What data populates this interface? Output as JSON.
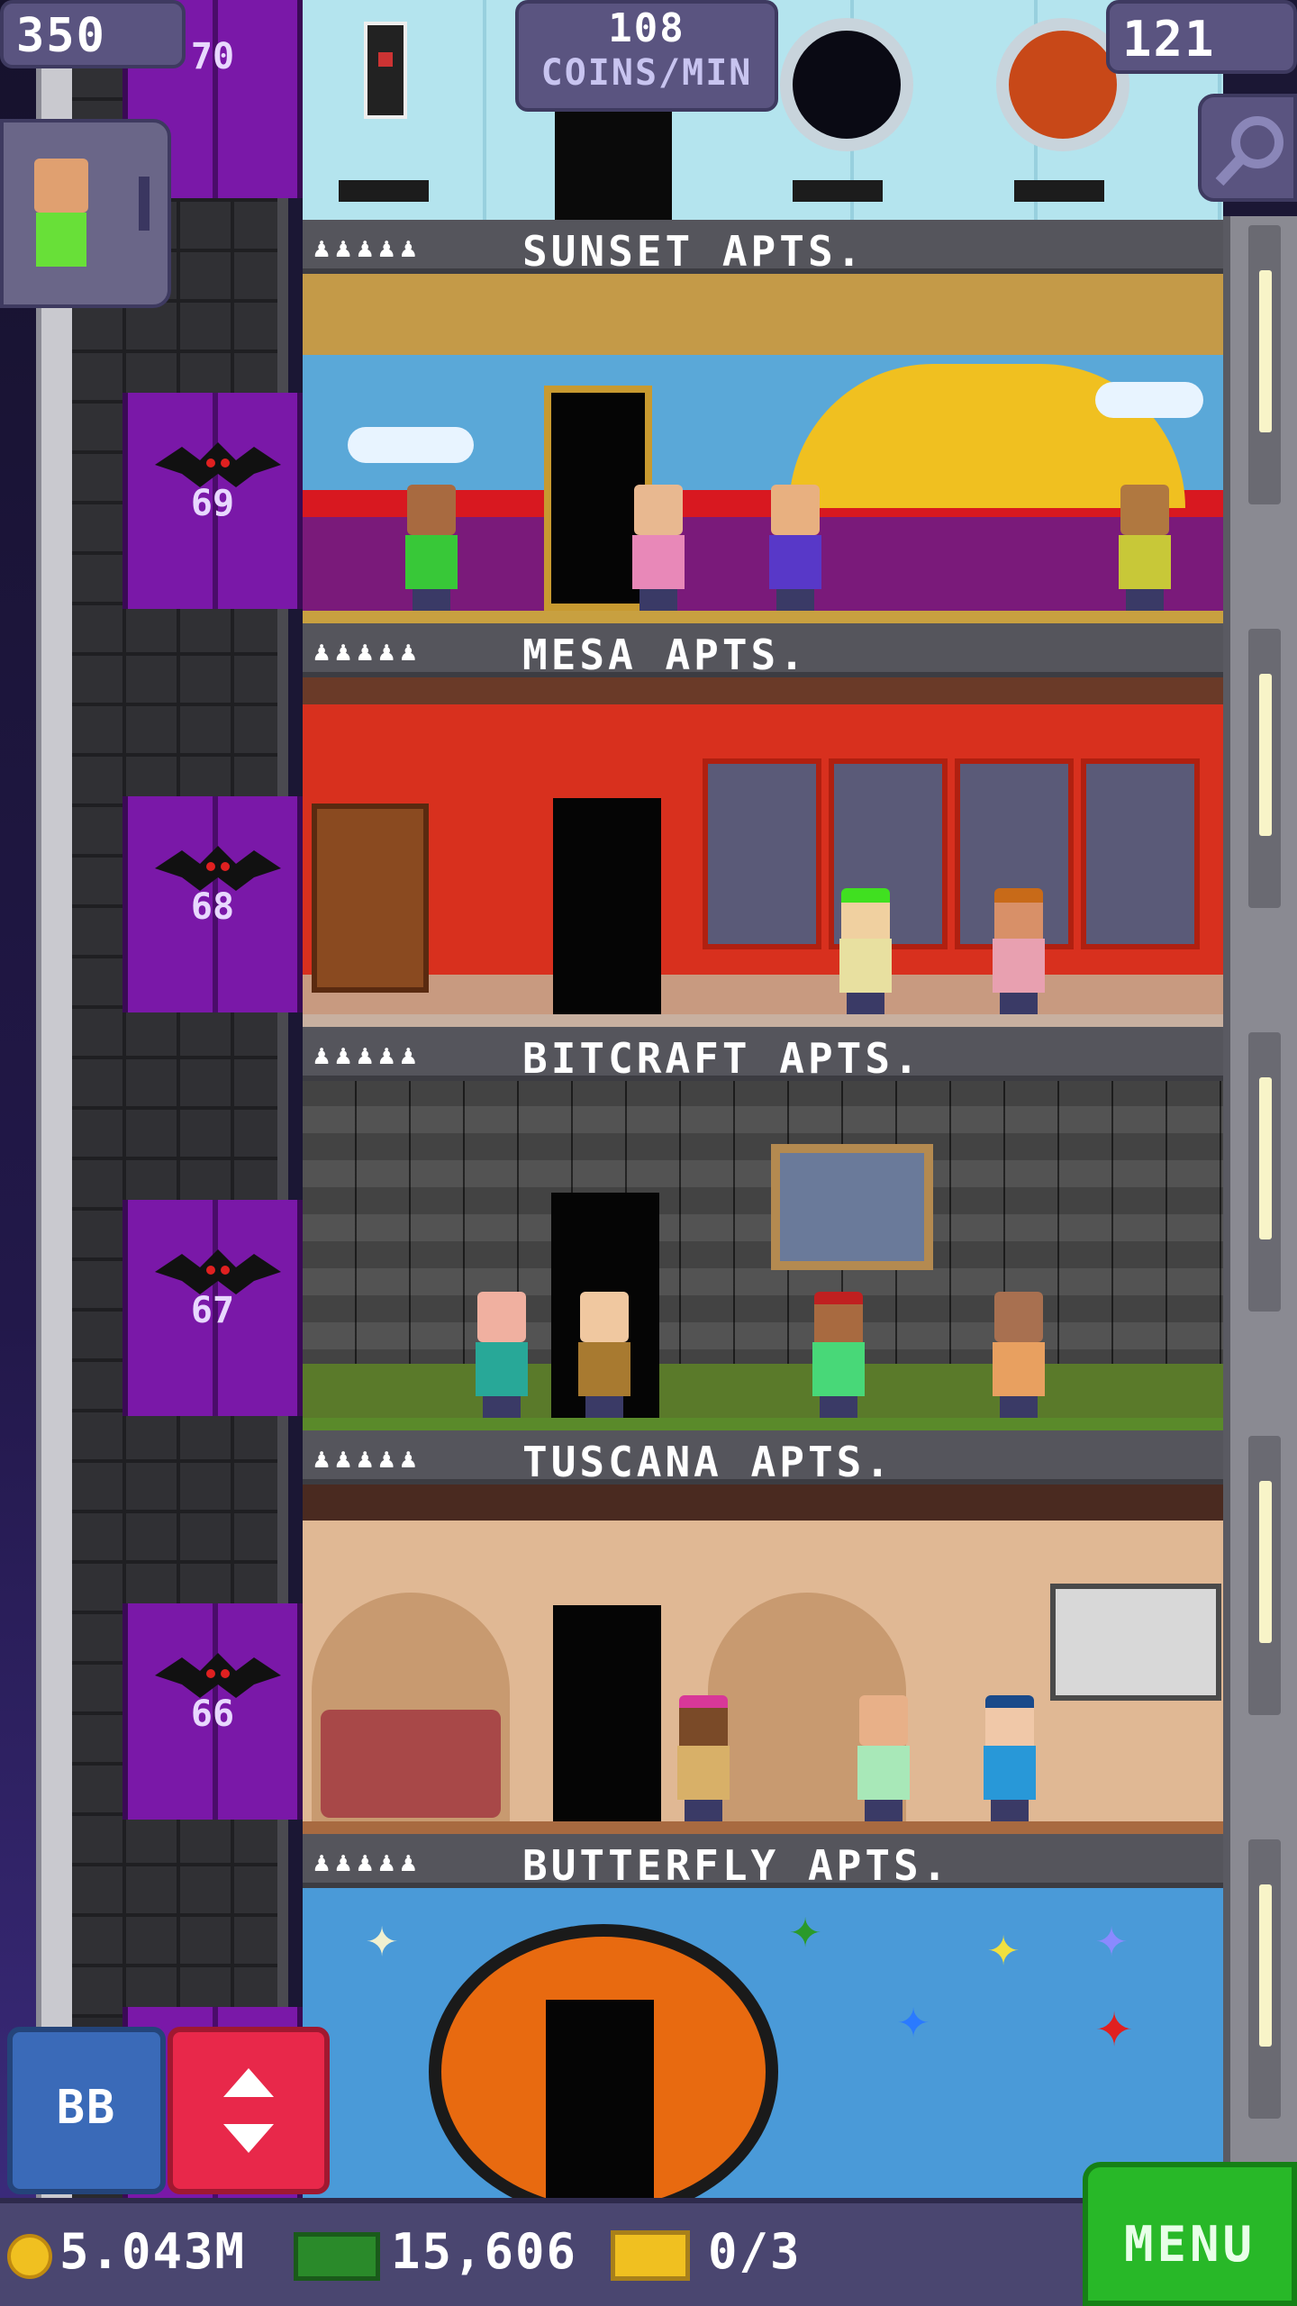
{
  "hud": {
    "population": "350",
    "coins_per_min_value": "108",
    "coins_per_min_label": "COINS/MIN",
    "floor_count": "121"
  },
  "elevator": {
    "floor_labels": [
      "70",
      "69",
      "68",
      "67",
      "66"
    ]
  },
  "floors": [
    {
      "name": "SUNSET APTS.",
      "theme": "sunset"
    },
    {
      "name": "MESA APTS.",
      "theme": "mesa"
    },
    {
      "name": "BITCRAFT APTS.",
      "theme": "bitcraft"
    },
    {
      "name": "TUSCANA APTS.",
      "theme": "tuscana"
    },
    {
      "name": "BUTTERFLY APTS.",
      "theme": "butterfly"
    }
  ],
  "resident_icons": "♟♟♟♟♟",
  "controls": {
    "bb_label": "BB",
    "menu_label": "MENU"
  },
  "currency": {
    "coins": "5.043M",
    "bux": "15,606",
    "tickets": "0/3"
  },
  "colors": {
    "elevator_door": "#7a18a8",
    "menu_button": "#28b828",
    "elevator_button": "#e8284a",
    "bb_button": "#3a6ab8"
  }
}
